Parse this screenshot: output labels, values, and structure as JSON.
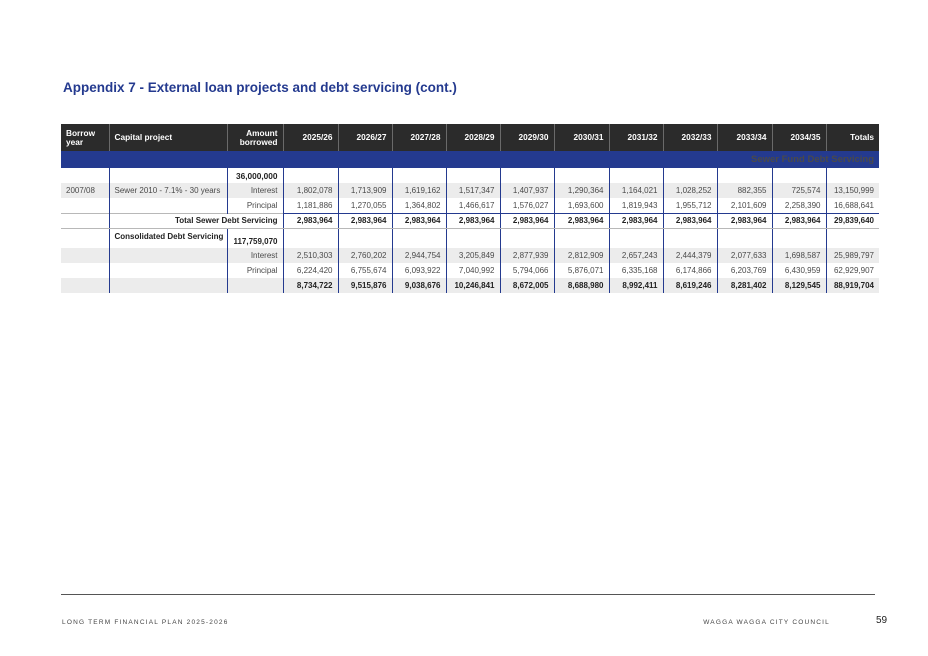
{
  "title": "Appendix 7 - External loan projects and debt servicing (cont.)",
  "headers": {
    "borrow_year": "Borrow year",
    "capital_project": "Capital project",
    "amount_borrowed": "Amount borrowed",
    "years": [
      "2025/26",
      "2026/27",
      "2027/28",
      "2028/29",
      "2029/30",
      "2030/31",
      "2031/32",
      "2032/33",
      "2033/34",
      "2034/35"
    ],
    "totals": "Totals"
  },
  "section": "Sewer Fund Debt Servicing",
  "sewer": {
    "amount": "36,000,000",
    "borrow_year": "2007/08",
    "project": "Sewer 2010 - 7.1% - 30 years",
    "interest_label": "Interest",
    "interest": [
      "1,802,078",
      "1,713,909",
      "1,619,162",
      "1,517,347",
      "1,407,937",
      "1,290,364",
      "1,164,021",
      "1,028,252",
      "882,355",
      "725,574",
      "13,150,999"
    ],
    "principal_label": "Principal",
    "principal": [
      "1,181,886",
      "1,270,055",
      "1,364,802",
      "1,466,617",
      "1,576,027",
      "1,693,600",
      "1,819,943",
      "1,955,712",
      "2,101,609",
      "2,258,390",
      "16,688,641"
    ],
    "total_label": "Total Sewer Debt Servicing",
    "total": [
      "2,983,964",
      "2,983,964",
      "2,983,964",
      "2,983,964",
      "2,983,964",
      "2,983,964",
      "2,983,964",
      "2,983,964",
      "2,983,964",
      "2,983,964",
      "29,839,640"
    ]
  },
  "consolidated": {
    "label": "Consolidated Debt Servicing",
    "amount": "117,759,070",
    "interest_label": "Interest",
    "interest": [
      "2,510,303",
      "2,760,202",
      "2,944,754",
      "3,205,849",
      "2,877,939",
      "2,812,909",
      "2,657,243",
      "2,444,379",
      "2,077,633",
      "1,698,587",
      "25,989,797"
    ],
    "principal_label": "Principal",
    "principal": [
      "6,224,420",
      "6,755,674",
      "6,093,922",
      "7,040,992",
      "5,794,066",
      "5,876,071",
      "6,335,168",
      "6,174,866",
      "6,203,769",
      "6,430,959",
      "62,929,907"
    ],
    "total": [
      "8,734,722",
      "9,515,876",
      "9,038,676",
      "10,246,841",
      "8,672,005",
      "8,688,980",
      "8,992,411",
      "8,619,246",
      "8,281,402",
      "8,129,545",
      "88,919,704"
    ]
  },
  "footer": {
    "left": "LONG TERM FINANCIAL PLAN 2025-2026",
    "right": "WAGGA WAGGA CITY COUNCIL",
    "page": "59"
  }
}
